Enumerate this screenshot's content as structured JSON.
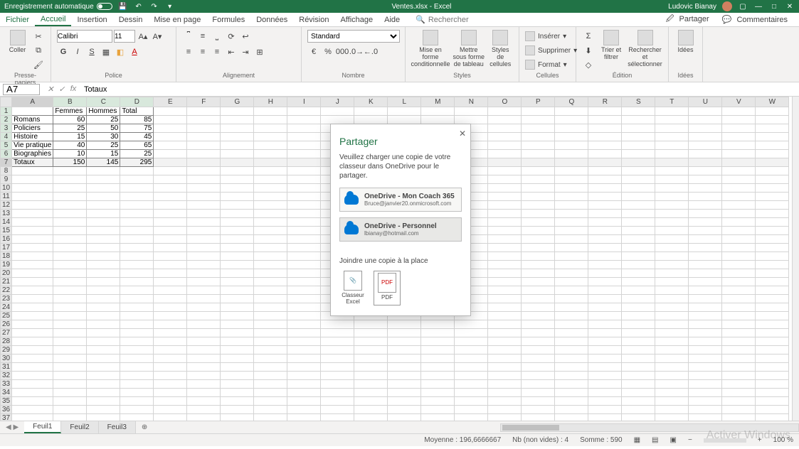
{
  "titlebar": {
    "autosave": "Enregistrement automatique",
    "title": "Ventes.xlsx - Excel",
    "user": "Ludovic Bianay"
  },
  "tabs": {
    "file": "Fichier",
    "home": "Accueil",
    "insert": "Insertion",
    "draw": "Dessin",
    "layout": "Mise en page",
    "formulas": "Formules",
    "data": "Données",
    "review": "Révision",
    "view": "Affichage",
    "help": "Aide",
    "search": "Rechercher",
    "share": "Partager",
    "comments": "Commentaires"
  },
  "ribbon": {
    "paste": "Coller",
    "clipboard": "Presse-papiers",
    "font": "Police",
    "fontname": "Calibri",
    "fontsize": "11",
    "alignment": "Alignement",
    "number": "Nombre",
    "numfmt": "Standard",
    "cond": "Mise en forme conditionnelle",
    "fmttable": "Mettre sous forme de tableau",
    "cellstyles": "Styles de cellules",
    "styles": "Styles",
    "insert": "Insérer",
    "delete": "Supprimer",
    "format": "Format",
    "cells": "Cellules",
    "sort": "Trier et filtrer",
    "find": "Rechercher et sélectionner",
    "editing": "Édition",
    "ideas": "Idées",
    "ideasgrp": "Idées"
  },
  "formula": {
    "cell": "A7",
    "value": "Totaux"
  },
  "data": {
    "headers": [
      "",
      "Femmes",
      "Hommes",
      "Total"
    ],
    "rows": [
      [
        "Romans",
        60,
        25,
        85
      ],
      [
        "Policiers",
        25,
        50,
        75
      ],
      [
        "Histoire",
        15,
        30,
        45
      ],
      [
        "Vie pratique",
        40,
        25,
        65
      ],
      [
        "Biographies",
        10,
        15,
        25
      ],
      [
        "Totaux",
        150,
        145,
        295
      ]
    ]
  },
  "columns": [
    "A",
    "B",
    "C",
    "D",
    "E",
    "F",
    "G",
    "H",
    "I",
    "J",
    "K",
    "L",
    "M",
    "N",
    "O",
    "P",
    "Q",
    "R",
    "S",
    "T",
    "U",
    "V",
    "W"
  ],
  "sheets": {
    "s1": "Feuil1",
    "s2": "Feuil2",
    "s3": "Feuil3"
  },
  "status": {
    "avg": "Moyenne : 196,6666667",
    "count": "Nb (non vides) : 4",
    "sum": "Somme : 590",
    "zoom": "100 %"
  },
  "watermark": "Activer Windows",
  "dialog": {
    "title": "Partager",
    "text": "Veuillez charger une copie de votre classeur dans OneDrive pour le partager.",
    "od1t": "OneDrive - Mon Coach 365",
    "od1s": "Bruce@janvier20.onmicrosoft.com",
    "od2t": "OneDrive - Personnel",
    "od2s": "lbianay@hotmail.com",
    "attach": "Joindre une copie à la place",
    "opt1a": "Classeur",
    "opt1b": "Excel",
    "opt2": "PDF"
  }
}
